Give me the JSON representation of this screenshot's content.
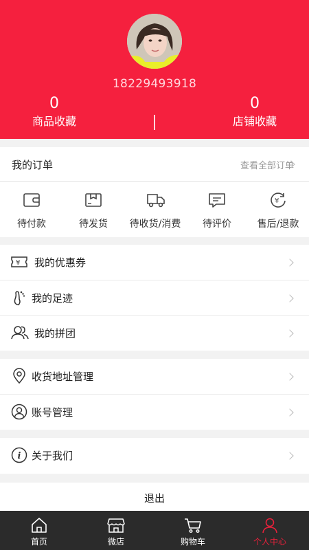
{
  "profile": {
    "phone": "18229493918",
    "stats": [
      {
        "count": "0",
        "label": "商品收藏"
      },
      {
        "count": "0",
        "label": "店铺收藏"
      }
    ]
  },
  "orders": {
    "title": "我的订单",
    "view_all": "查看全部订单",
    "items": [
      {
        "label": "待付款",
        "icon": "wallet-icon"
      },
      {
        "label": "待发货",
        "icon": "package-icon"
      },
      {
        "label": "待收货/消费",
        "icon": "truck-icon"
      },
      {
        "label": "待评价",
        "icon": "comment-icon"
      },
      {
        "label": "售后/退款",
        "icon": "refund-icon"
      }
    ]
  },
  "menu_group_1": [
    {
      "label": "我的优惠券",
      "icon": "coupon-icon"
    },
    {
      "label": "我的足迹",
      "icon": "footprint-icon"
    },
    {
      "label": "我的拼团",
      "icon": "group-buy-icon"
    }
  ],
  "menu_group_2": [
    {
      "label": "收货地址管理",
      "icon": "location-icon"
    },
    {
      "label": "账号管理",
      "icon": "account-icon"
    }
  ],
  "menu_group_3": [
    {
      "label": "关于我们",
      "icon": "info-icon"
    }
  ],
  "logout_label": "退出",
  "tabbar": [
    {
      "label": "首页",
      "icon": "home-icon"
    },
    {
      "label": "微店",
      "icon": "store-icon"
    },
    {
      "label": "购物车",
      "icon": "cart-icon"
    },
    {
      "label": "个人中心",
      "icon": "user-icon",
      "active": true
    }
  ],
  "colors": {
    "brand": "#f5203e",
    "tab_active": "#e8213b",
    "tabbar_bg": "#2b2b2b"
  }
}
